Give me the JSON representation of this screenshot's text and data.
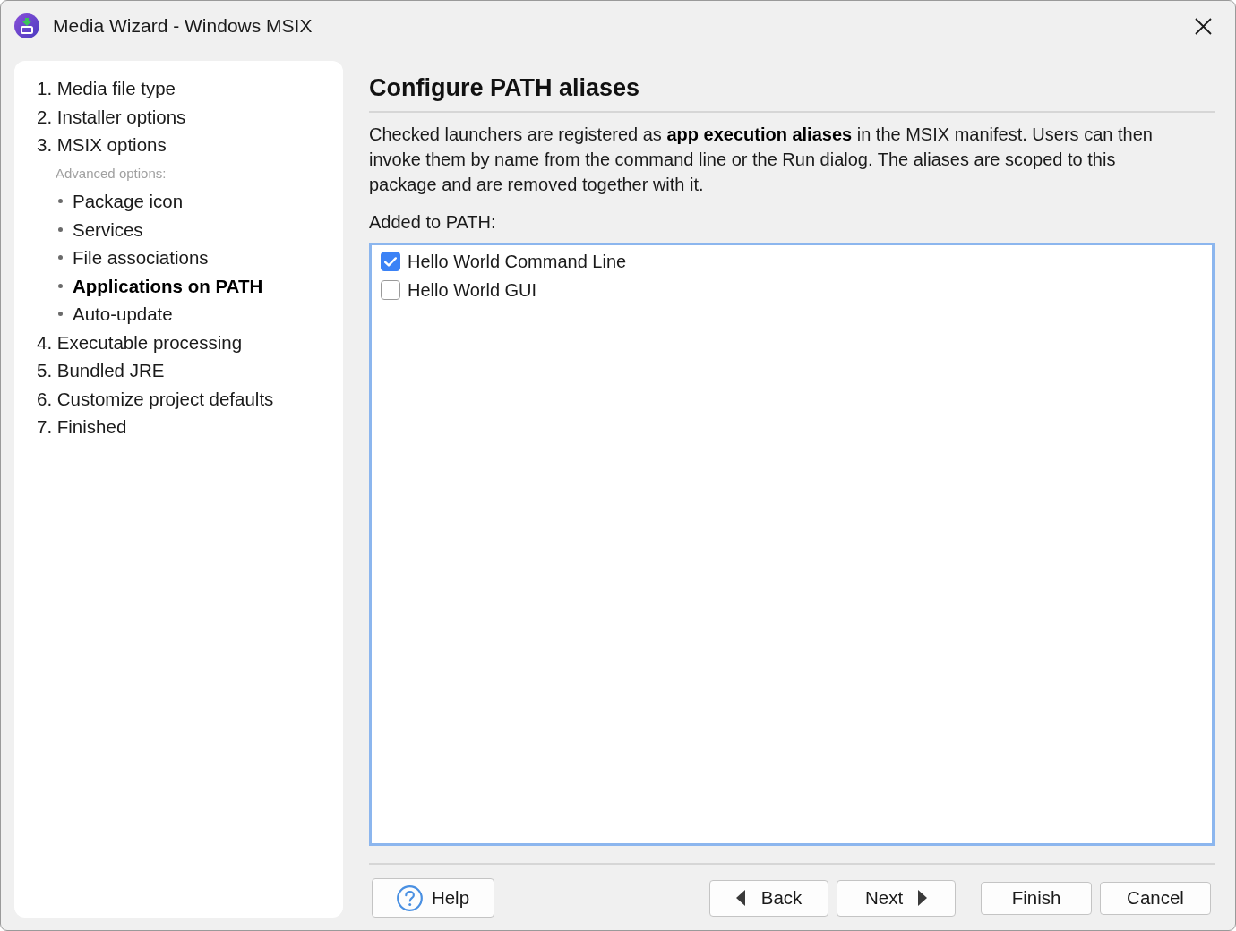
{
  "window": {
    "title": "Media Wizard - Windows MSIX"
  },
  "steps": [
    {
      "label": "1. Media file type",
      "selected": false
    },
    {
      "label": "2. Installer options",
      "selected": false
    },
    {
      "label": "3. MSIX options",
      "selected": false,
      "children_heading": "Advanced options:",
      "children": [
        {
          "label": "Package icon",
          "selected": false
        },
        {
          "label": "Services",
          "selected": false
        },
        {
          "label": "File associations",
          "selected": false
        },
        {
          "label": "Applications on PATH",
          "selected": true
        },
        {
          "label": "Auto-update",
          "selected": false
        }
      ]
    },
    {
      "label": "4. Executable processing",
      "selected": false
    },
    {
      "label": "5. Bundled JRE",
      "selected": false
    },
    {
      "label": "6. Customize project defaults",
      "selected": false
    },
    {
      "label": "7. Finished",
      "selected": false
    }
  ],
  "page": {
    "heading": "Configure PATH aliases",
    "description": "Checked launchers are registered as **app execution aliases** in the MSIX manifest. Users can then invoke them by name from the command line or the Run dialog. The aliases are scoped to this package and are removed together with it.",
    "list_label": "Added to PATH:",
    "launchers": [
      {
        "label": "Hello World Command Line",
        "checked": true
      },
      {
        "label": "Hello World GUI",
        "checked": false
      }
    ]
  },
  "buttons": [
    {
      "label": "Help",
      "kind": "help"
    },
    {
      "label": "Back",
      "kind": "back"
    },
    {
      "label": "Next",
      "kind": "next"
    },
    {
      "label": "Finish",
      "kind": "plain"
    },
    {
      "label": "Cancel",
      "kind": "plain"
    }
  ]
}
